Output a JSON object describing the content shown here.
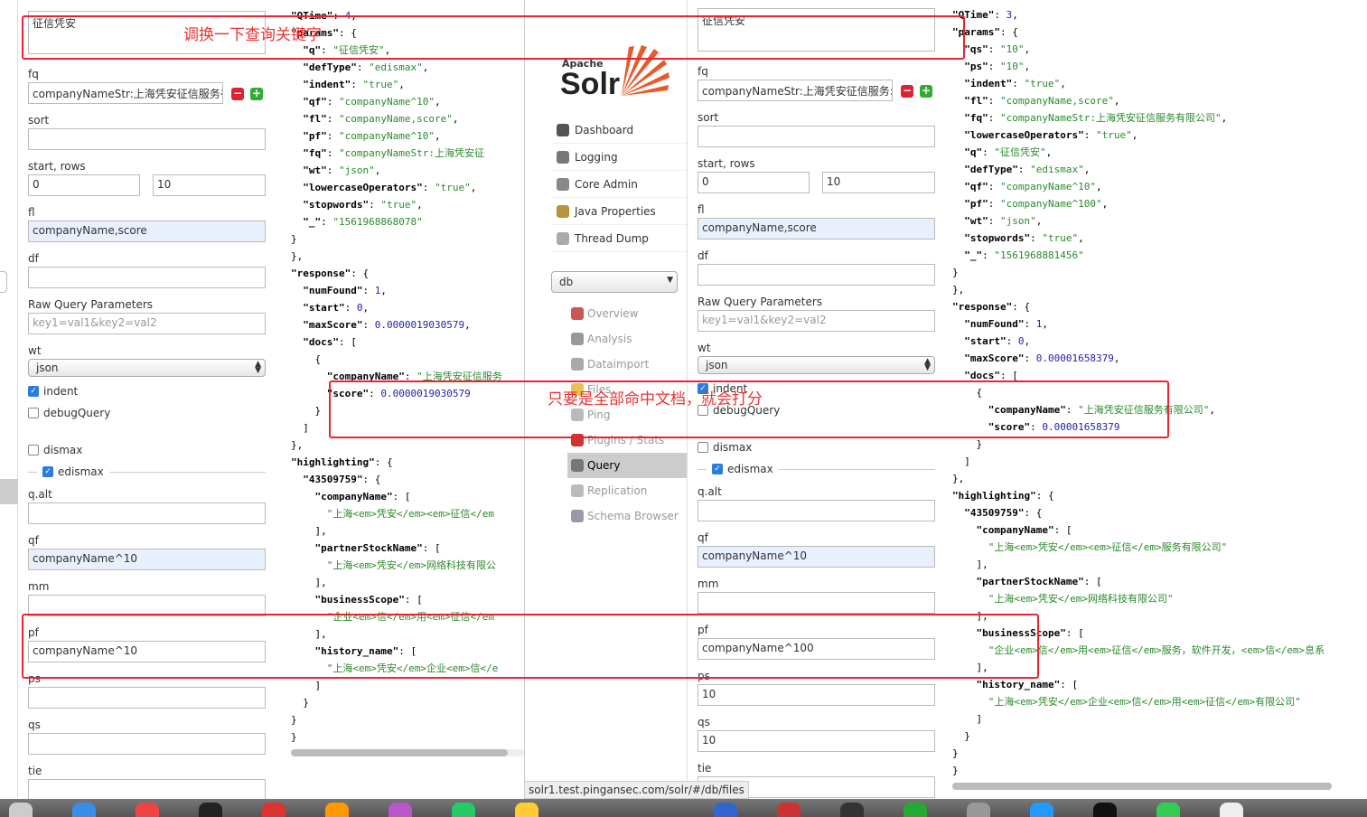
{
  "left": {
    "q_value": "征信凭安",
    "fields": {
      "fq": {
        "label": "fq",
        "value": "companyNameStr:上海凭安征信服务有"
      },
      "sort": {
        "label": "sort",
        "value": ""
      },
      "start_rows": {
        "label": "start, rows",
        "start": "0",
        "rows": "10"
      },
      "fl": {
        "label": "fl",
        "value": "companyName,score"
      },
      "df": {
        "label": "df",
        "value": ""
      },
      "raw": {
        "label": "Raw Query Parameters",
        "placeholder": "key1=val1&key2=val2"
      },
      "wt": {
        "label": "wt",
        "value": "json"
      },
      "indent": "indent",
      "debug": "debugQuery",
      "dismax": "dismax",
      "edismax": "edismax",
      "qalt": {
        "label": "q.alt",
        "value": ""
      },
      "qf": {
        "label": "qf",
        "value": "companyName^10"
      },
      "mm": {
        "label": "mm",
        "value": ""
      },
      "pf": {
        "label": "pf",
        "value": "companyName^10"
      },
      "ps": {
        "label": "ps",
        "value": ""
      },
      "qs": {
        "label": "qs",
        "value": ""
      },
      "tie": {
        "label": "tie",
        "value": ""
      }
    }
  },
  "right": {
    "q_value": "征信凭安",
    "fields": {
      "fq": {
        "label": "fq",
        "value": "companyNameStr:上海凭安征信服务:"
      },
      "sort": {
        "label": "sort",
        "value": ""
      },
      "start_rows": {
        "label": "start, rows",
        "start": "0",
        "rows": "10"
      },
      "fl": {
        "label": "fl",
        "value": "companyName,score"
      },
      "df": {
        "label": "df",
        "value": ""
      },
      "raw": {
        "label": "Raw Query Parameters",
        "placeholder": "key1=val1&key2=val2"
      },
      "wt": {
        "label": "wt",
        "value": "json"
      },
      "indent": "indent",
      "debug": "debugQuery",
      "dismax": "dismax",
      "edismax": "edismax",
      "qalt": {
        "label": "q.alt",
        "value": ""
      },
      "qf": {
        "label": "qf",
        "value": "companyName^10"
      },
      "mm": {
        "label": "mm",
        "value": ""
      },
      "pf": {
        "label": "pf",
        "value": "companyName^100"
      },
      "ps": {
        "label": "ps",
        "value": "10"
      },
      "qs": {
        "label": "qs",
        "value": "10"
      },
      "tie": {
        "label": "tie",
        "value": ""
      }
    }
  },
  "logo": {
    "apache": "Apache",
    "solr": "Solr"
  },
  "nav": [
    {
      "label": "Dashboard",
      "icon": "dashboard-icon",
      "color": "#555"
    },
    {
      "label": "Logging",
      "icon": "logging-icon",
      "color": "#777"
    },
    {
      "label": "Core Admin",
      "icon": "core-admin-icon",
      "color": "#888"
    },
    {
      "label": "Java Properties",
      "icon": "java-icon",
      "color": "#b8943c"
    },
    {
      "label": "Thread Dump",
      "icon": "thread-dump-icon",
      "color": "#aaa"
    }
  ],
  "core_select": "db",
  "core_menu": [
    {
      "label": "Overview",
      "icon": "overview-icon",
      "color": "#c55"
    },
    {
      "label": "Analysis",
      "icon": "analysis-icon",
      "color": "#999"
    },
    {
      "label": "Dataimport",
      "icon": "dataimport-icon",
      "color": "#aaa"
    },
    {
      "label": "Files",
      "icon": "files-icon",
      "color": "#e8c150"
    },
    {
      "label": "Ping",
      "icon": "ping-icon",
      "color": "#bbb"
    },
    {
      "label": "Plugins / Stats",
      "icon": "plugins-icon",
      "color": "#c33"
    },
    {
      "label": "Query",
      "icon": "query-icon",
      "color": "#777"
    },
    {
      "label": "Replication",
      "icon": "replication-icon",
      "color": "#bbb"
    },
    {
      "label": "Schema Browser",
      "icon": "schema-browser-icon",
      "color": "#99a"
    }
  ],
  "status_url": "solr1.test.pingansec.com/solr/#/db/files",
  "annotations": {
    "top": "调换一下查询关键字",
    "middle": "只要是全部命中文档，就会打分"
  },
  "left_json": [
    [
      [
        "k",
        "\"QTime\""
      ],
      [
        "p",
        ": "
      ],
      [
        "n",
        "4"
      ],
      [
        "p",
        ","
      ]
    ],
    [
      [
        "k",
        "\"params\""
      ],
      [
        "p",
        ": {"
      ]
    ],
    [
      [
        "p",
        "  "
      ],
      [
        "k",
        "\"q\""
      ],
      [
        "p",
        ": "
      ],
      [
        "s",
        "\"征信凭安\""
      ],
      [
        "p",
        ","
      ]
    ],
    [
      [
        "p",
        "  "
      ],
      [
        "k",
        "\"defType\""
      ],
      [
        "p",
        ": "
      ],
      [
        "s",
        "\"edismax\""
      ],
      [
        "p",
        ","
      ]
    ],
    [
      [
        "p",
        "  "
      ],
      [
        "k",
        "\"indent\""
      ],
      [
        "p",
        ": "
      ],
      [
        "s",
        "\"true\""
      ],
      [
        "p",
        ","
      ]
    ],
    [
      [
        "p",
        "  "
      ],
      [
        "k",
        "\"qf\""
      ],
      [
        "p",
        ": "
      ],
      [
        "s",
        "\"companyName^10\""
      ],
      [
        "p",
        ","
      ]
    ],
    [
      [
        "p",
        "  "
      ],
      [
        "k",
        "\"fl\""
      ],
      [
        "p",
        ": "
      ],
      [
        "s",
        "\"companyName,score\""
      ],
      [
        "p",
        ","
      ]
    ],
    [
      [
        "p",
        "  "
      ],
      [
        "k",
        "\"pf\""
      ],
      [
        "p",
        ": "
      ],
      [
        "s",
        "\"companyName^10\""
      ],
      [
        "p",
        ","
      ]
    ],
    [
      [
        "p",
        "  "
      ],
      [
        "k",
        "\"fq\""
      ],
      [
        "p",
        ": "
      ],
      [
        "s",
        "\"companyNameStr:上海凭安征"
      ]
    ],
    [
      [
        "p",
        "  "
      ],
      [
        "k",
        "\"wt\""
      ],
      [
        "p",
        ": "
      ],
      [
        "s",
        "\"json\""
      ],
      [
        "p",
        ","
      ]
    ],
    [
      [
        "p",
        "  "
      ],
      [
        "k",
        "\"lowercaseOperators\""
      ],
      [
        "p",
        ": "
      ],
      [
        "s",
        "\"true\""
      ],
      [
        "p",
        ","
      ]
    ],
    [
      [
        "p",
        "  "
      ],
      [
        "k",
        "\"stopwords\""
      ],
      [
        "p",
        ": "
      ],
      [
        "s",
        "\"true\""
      ],
      [
        "p",
        ","
      ]
    ],
    [
      [
        "p",
        "  "
      ],
      [
        "k",
        "\"_\""
      ],
      [
        "p",
        ": "
      ],
      [
        "s",
        "\"1561968868078\""
      ]
    ],
    [
      [
        "p",
        "}"
      ]
    ],
    [
      [
        "p",
        "},"
      ]
    ],
    [
      [
        "k",
        "\"response\""
      ],
      [
        "p",
        ": {"
      ]
    ],
    [
      [
        "p",
        "  "
      ],
      [
        "k",
        "\"numFound\""
      ],
      [
        "p",
        ": "
      ],
      [
        "n",
        "1"
      ],
      [
        "p",
        ","
      ]
    ],
    [
      [
        "p",
        "  "
      ],
      [
        "k",
        "\"start\""
      ],
      [
        "p",
        ": "
      ],
      [
        "n",
        "0"
      ],
      [
        "p",
        ","
      ]
    ],
    [
      [
        "p",
        "  "
      ],
      [
        "k",
        "\"maxScore\""
      ],
      [
        "p",
        ": "
      ],
      [
        "n",
        "0.0000019030579"
      ],
      [
        "p",
        ","
      ]
    ],
    [
      [
        "p",
        "  "
      ],
      [
        "k",
        "\"docs\""
      ],
      [
        "p",
        ": ["
      ]
    ],
    [
      [
        "p",
        "    {"
      ]
    ],
    [
      [
        "p",
        "      "
      ],
      [
        "k",
        "\"companyName\""
      ],
      [
        "p",
        ": "
      ],
      [
        "s",
        "\"上海凭安征信服务"
      ]
    ],
    [
      [
        "p",
        "      "
      ],
      [
        "k",
        "\"score\""
      ],
      [
        "p",
        ": "
      ],
      [
        "n",
        "0.0000019030579"
      ]
    ],
    [
      [
        "p",
        "    }"
      ]
    ],
    [
      [
        "p",
        "  ]"
      ]
    ],
    [
      [
        "p",
        "},"
      ]
    ],
    [
      [
        "k",
        "\"highlighting\""
      ],
      [
        "p",
        ": {"
      ]
    ],
    [
      [
        "p",
        "  "
      ],
      [
        "k",
        "\"43509759\""
      ],
      [
        "p",
        ": {"
      ]
    ],
    [
      [
        "p",
        "    "
      ],
      [
        "k",
        "\"companyName\""
      ],
      [
        "p",
        ": ["
      ]
    ],
    [
      [
        "p",
        "      "
      ],
      [
        "s",
        "\"上海<em>凭安</em><em>征信</em"
      ]
    ],
    [
      [
        "p",
        "    ],"
      ]
    ],
    [
      [
        "p",
        "    "
      ],
      [
        "k",
        "\"partnerStockName\""
      ],
      [
        "p",
        ": ["
      ]
    ],
    [
      [
        "p",
        "      "
      ],
      [
        "s",
        "\"上海<em>凭安</em>网络科技有限公"
      ]
    ],
    [
      [
        "p",
        "    ],"
      ]
    ],
    [
      [
        "p",
        "    "
      ],
      [
        "k",
        "\"businessScope\""
      ],
      [
        "p",
        ": ["
      ]
    ],
    [
      [
        "p",
        "      "
      ],
      [
        "s",
        "\"企业<em>信</em>用<em>征信</em"
      ]
    ],
    [
      [
        "p",
        "    ],"
      ]
    ],
    [
      [
        "p",
        "    "
      ],
      [
        "k",
        "\"history_name\""
      ],
      [
        "p",
        ": ["
      ]
    ],
    [
      [
        "p",
        "      "
      ],
      [
        "s",
        "\"上海<em>凭安</em>企业<em>信</e"
      ]
    ],
    [
      [
        "p",
        "    ]"
      ]
    ],
    [
      [
        "p",
        "  }"
      ]
    ],
    [
      [
        "p",
        "}"
      ]
    ],
    [
      [
        "p",
        "}"
      ]
    ]
  ],
  "right_json": [
    [
      [
        "k",
        "\"QTime\""
      ],
      [
        "p",
        ": "
      ],
      [
        "n",
        "3"
      ],
      [
        "p",
        ","
      ]
    ],
    [
      [
        "k",
        "\"params\""
      ],
      [
        "p",
        ": {"
      ]
    ],
    [
      [
        "p",
        "  "
      ],
      [
        "k",
        "\"qs\""
      ],
      [
        "p",
        ": "
      ],
      [
        "s",
        "\"10\""
      ],
      [
        "p",
        ","
      ]
    ],
    [
      [
        "p",
        "  "
      ],
      [
        "k",
        "\"ps\""
      ],
      [
        "p",
        ": "
      ],
      [
        "s",
        "\"10\""
      ],
      [
        "p",
        ","
      ]
    ],
    [
      [
        "p",
        "  "
      ],
      [
        "k",
        "\"indent\""
      ],
      [
        "p",
        ": "
      ],
      [
        "s",
        "\"true\""
      ],
      [
        "p",
        ","
      ]
    ],
    [
      [
        "p",
        "  "
      ],
      [
        "k",
        "\"fl\""
      ],
      [
        "p",
        ": "
      ],
      [
        "s",
        "\"companyName,score\""
      ],
      [
        "p",
        ","
      ]
    ],
    [
      [
        "p",
        "  "
      ],
      [
        "k",
        "\"fq\""
      ],
      [
        "p",
        ": "
      ],
      [
        "s",
        "\"companyNameStr:上海凭安征信服务有限公司\""
      ],
      [
        "p",
        ","
      ]
    ],
    [
      [
        "p",
        "  "
      ],
      [
        "k",
        "\"lowercaseOperators\""
      ],
      [
        "p",
        ": "
      ],
      [
        "s",
        "\"true\""
      ],
      [
        "p",
        ","
      ]
    ],
    [
      [
        "p",
        "  "
      ],
      [
        "k",
        "\"q\""
      ],
      [
        "p",
        ": "
      ],
      [
        "s",
        "\"征信凭安\""
      ],
      [
        "p",
        ","
      ]
    ],
    [
      [
        "p",
        "  "
      ],
      [
        "k",
        "\"defType\""
      ],
      [
        "p",
        ": "
      ],
      [
        "s",
        "\"edismax\""
      ],
      [
        "p",
        ","
      ]
    ],
    [
      [
        "p",
        "  "
      ],
      [
        "k",
        "\"qf\""
      ],
      [
        "p",
        ": "
      ],
      [
        "s",
        "\"companyName^10\""
      ],
      [
        "p",
        ","
      ]
    ],
    [
      [
        "p",
        "  "
      ],
      [
        "k",
        "\"pf\""
      ],
      [
        "p",
        ": "
      ],
      [
        "s",
        "\"companyName^100\""
      ],
      [
        "p",
        ","
      ]
    ],
    [
      [
        "p",
        "  "
      ],
      [
        "k",
        "\"wt\""
      ],
      [
        "p",
        ": "
      ],
      [
        "s",
        "\"json\""
      ],
      [
        "p",
        ","
      ]
    ],
    [
      [
        "p",
        "  "
      ],
      [
        "k",
        "\"stopwords\""
      ],
      [
        "p",
        ": "
      ],
      [
        "s",
        "\"true\""
      ],
      [
        "p",
        ","
      ]
    ],
    [
      [
        "p",
        "  "
      ],
      [
        "k",
        "\"_\""
      ],
      [
        "p",
        ": "
      ],
      [
        "s",
        "\"1561968881456\""
      ]
    ],
    [
      [
        "p",
        "}"
      ]
    ],
    [
      [
        "p",
        "},"
      ]
    ],
    [
      [
        "k",
        "\"response\""
      ],
      [
        "p",
        ": {"
      ]
    ],
    [
      [
        "p",
        "  "
      ],
      [
        "k",
        "\"numFound\""
      ],
      [
        "p",
        ": "
      ],
      [
        "n",
        "1"
      ],
      [
        "p",
        ","
      ]
    ],
    [
      [
        "p",
        "  "
      ],
      [
        "k",
        "\"start\""
      ],
      [
        "p",
        ": "
      ],
      [
        "n",
        "0"
      ],
      [
        "p",
        ","
      ]
    ],
    [
      [
        "p",
        "  "
      ],
      [
        "k",
        "\"maxScore\""
      ],
      [
        "p",
        ": "
      ],
      [
        "n",
        "0.00001658379"
      ],
      [
        "p",
        ","
      ]
    ],
    [
      [
        "p",
        "  "
      ],
      [
        "k",
        "\"docs\""
      ],
      [
        "p",
        ": ["
      ]
    ],
    [
      [
        "p",
        "    {"
      ]
    ],
    [
      [
        "p",
        "      "
      ],
      [
        "k",
        "\"companyName\""
      ],
      [
        "p",
        ": "
      ],
      [
        "s",
        "\"上海凭安征信服务有限公司\""
      ],
      [
        "p",
        ","
      ]
    ],
    [
      [
        "p",
        "      "
      ],
      [
        "k",
        "\"score\""
      ],
      [
        "p",
        ": "
      ],
      [
        "n",
        "0.00001658379"
      ]
    ],
    [
      [
        "p",
        "    }"
      ]
    ],
    [
      [
        "p",
        "  ]"
      ]
    ],
    [
      [
        "p",
        "},"
      ]
    ],
    [
      [
        "k",
        "\"highlighting\""
      ],
      [
        "p",
        ": {"
      ]
    ],
    [
      [
        "p",
        "  "
      ],
      [
        "k",
        "\"43509759\""
      ],
      [
        "p",
        ": {"
      ]
    ],
    [
      [
        "p",
        "    "
      ],
      [
        "k",
        "\"companyName\""
      ],
      [
        "p",
        ": ["
      ]
    ],
    [
      [
        "p",
        "      "
      ],
      [
        "s",
        "\"上海<em>凭安</em><em>征信</em>服务有限公司\""
      ]
    ],
    [
      [
        "p",
        "    ],"
      ]
    ],
    [
      [
        "p",
        "    "
      ],
      [
        "k",
        "\"partnerStockName\""
      ],
      [
        "p",
        ": ["
      ]
    ],
    [
      [
        "p",
        "      "
      ],
      [
        "s",
        "\"上海<em>凭安</em>网络科技有限公司\""
      ]
    ],
    [
      [
        "p",
        "    ],"
      ]
    ],
    [
      [
        "p",
        "    "
      ],
      [
        "k",
        "\"businessScope\""
      ],
      [
        "p",
        ": ["
      ]
    ],
    [
      [
        "p",
        "      "
      ],
      [
        "s",
        "\"企业<em>信</em>用<em>征信</em>服务，软件开发，<em>信</em>息系"
      ]
    ],
    [
      [
        "p",
        "    ],"
      ]
    ],
    [
      [
        "p",
        "    "
      ],
      [
        "k",
        "\"history_name\""
      ],
      [
        "p",
        ": ["
      ]
    ],
    [
      [
        "p",
        "      "
      ],
      [
        "s",
        "\"上海<em>凭安</em>企业<em>信</em>用<em>征信</em>有限公司\""
      ]
    ],
    [
      [
        "p",
        "    ]"
      ]
    ],
    [
      [
        "p",
        "  }"
      ]
    ],
    [
      [
        "p",
        "}"
      ]
    ],
    [
      [
        "p",
        "}"
      ]
    ]
  ]
}
